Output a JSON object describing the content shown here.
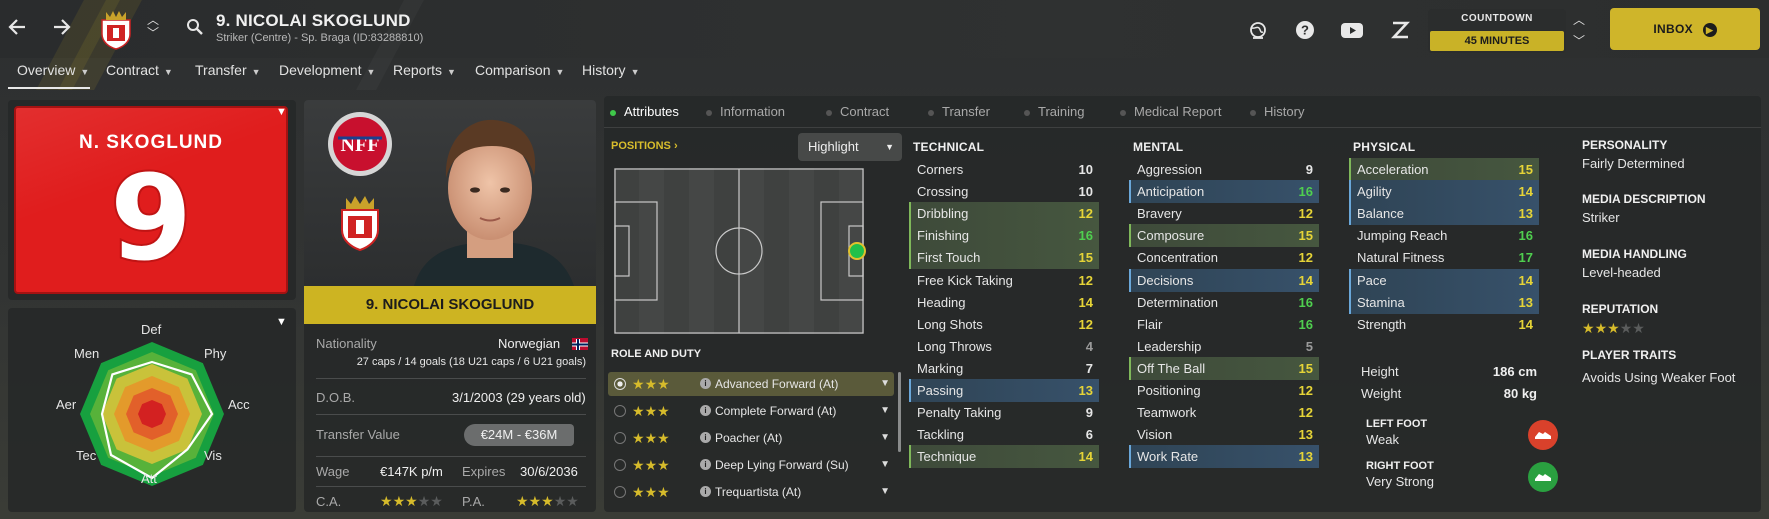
{
  "header": {
    "title": "9. NICOLAI SKOGLUND",
    "subtitle": "Striker (Centre) - Sp. Braga (ID:83288810)",
    "countdown_label": "COUNTDOWN",
    "countdown_value": "45 MINUTES",
    "inbox_label": "INBOX",
    "icons": [
      "back-arrow-icon",
      "forward-arrow-icon",
      "club-crest-icon",
      "up-down-arrows-icon",
      "search-icon",
      "globe-icon",
      "help-icon",
      "youtube-icon",
      "z-icon"
    ]
  },
  "nav": {
    "tabs": [
      "Overview",
      "Contract",
      "Transfer",
      "Development",
      "Reports",
      "Comparison",
      "History"
    ],
    "active": "Overview"
  },
  "kit": {
    "name": "N. SKOGLUND",
    "number": "9",
    "color": "#e01d1d"
  },
  "radar": {
    "labels": [
      "Def",
      "Phy",
      "Acc",
      "Vis",
      "Att",
      "Tec",
      "Aer",
      "Men"
    ]
  },
  "profile": {
    "banner": "9. NICOLAI SKOGLUND",
    "nationality_label": "Nationality",
    "nationality": "Norwegian",
    "caps": "27 caps / 14 goals (18 U21 caps / 6 U21 goals)",
    "dob_label": "D.O.B.",
    "dob": "3/1/2003 (29 years old)",
    "transfer_label": "Transfer Value",
    "transfer_value": "€24M - €36M",
    "wage_label": "Wage",
    "wage": "€147K p/m",
    "expires_label": "Expires",
    "expires": "30/6/2036",
    "ca_label": "C.A.",
    "pa_label": "P.A.",
    "ca_stars": 3,
    "pa_stars": 3
  },
  "subtabs": [
    "Attributes",
    "Information",
    "Contract",
    "Transfer",
    "Training",
    "Medical Report",
    "History"
  ],
  "positions": {
    "label": "POSITIONS",
    "highlight": "Highlight"
  },
  "role_duty": {
    "label": "ROLE AND DUTY",
    "roles": [
      {
        "name": "Advanced Forward (At)",
        "stars": 3,
        "selected": true
      },
      {
        "name": "Complete Forward (At)",
        "stars": 3,
        "selected": false
      },
      {
        "name": "Poacher (At)",
        "stars": 3,
        "selected": false
      },
      {
        "name": "Deep Lying Forward (Su)",
        "stars": 3,
        "selected": false
      },
      {
        "name": "Trequartista (At)",
        "stars": 3,
        "selected": false
      }
    ]
  },
  "technical": {
    "label": "TECHNICAL",
    "attrs": [
      {
        "name": "Corners",
        "value": "10",
        "hl": ""
      },
      {
        "name": "Crossing",
        "value": "10",
        "hl": ""
      },
      {
        "name": "Dribbling",
        "value": "12",
        "hl": "g"
      },
      {
        "name": "Finishing",
        "value": "16",
        "hl": "g"
      },
      {
        "name": "First Touch",
        "value": "15",
        "hl": "g"
      },
      {
        "name": "Free Kick Taking",
        "value": "12",
        "hl": ""
      },
      {
        "name": "Heading",
        "value": "14",
        "hl": ""
      },
      {
        "name": "Long Shots",
        "value": "12",
        "hl": ""
      },
      {
        "name": "Long Throws",
        "value": "4",
        "hl": ""
      },
      {
        "name": "Marking",
        "value": "7",
        "hl": ""
      },
      {
        "name": "Passing",
        "value": "13",
        "hl": "b"
      },
      {
        "name": "Penalty Taking",
        "value": "9",
        "hl": ""
      },
      {
        "name": "Tackling",
        "value": "6",
        "hl": ""
      },
      {
        "name": "Technique",
        "value": "14",
        "hl": "g"
      }
    ]
  },
  "mental": {
    "label": "MENTAL",
    "attrs": [
      {
        "name": "Aggression",
        "value": "9",
        "hl": ""
      },
      {
        "name": "Anticipation",
        "value": "16",
        "hl": "b"
      },
      {
        "name": "Bravery",
        "value": "12",
        "hl": ""
      },
      {
        "name": "Composure",
        "value": "15",
        "hl": "g"
      },
      {
        "name": "Concentration",
        "value": "12",
        "hl": ""
      },
      {
        "name": "Decisions",
        "value": "14",
        "hl": "b"
      },
      {
        "name": "Determination",
        "value": "16",
        "hl": ""
      },
      {
        "name": "Flair",
        "value": "16",
        "hl": ""
      },
      {
        "name": "Leadership",
        "value": "5",
        "hl": ""
      },
      {
        "name": "Off The Ball",
        "value": "15",
        "hl": "g"
      },
      {
        "name": "Positioning",
        "value": "12",
        "hl": ""
      },
      {
        "name": "Teamwork",
        "value": "12",
        "hl": ""
      },
      {
        "name": "Vision",
        "value": "13",
        "hl": ""
      },
      {
        "name": "Work Rate",
        "value": "13",
        "hl": "b"
      }
    ]
  },
  "physical": {
    "label": "PHYSICAL",
    "attrs": [
      {
        "name": "Acceleration",
        "value": "15",
        "hl": "g"
      },
      {
        "name": "Agility",
        "value": "14",
        "hl": "b"
      },
      {
        "name": "Balance",
        "value": "13",
        "hl": "b"
      },
      {
        "name": "Jumping Reach",
        "value": "16",
        "hl": ""
      },
      {
        "name": "Natural Fitness",
        "value": "17",
        "hl": ""
      },
      {
        "name": "Pace",
        "value": "14",
        "hl": "b"
      },
      {
        "name": "Stamina",
        "value": "13",
        "hl": "b"
      },
      {
        "name": "Strength",
        "value": "14",
        "hl": ""
      }
    ],
    "height_label": "Height",
    "height": "186 cm",
    "weight_label": "Weight",
    "weight": "80 kg",
    "left_foot_label": "LEFT FOOT",
    "left_foot": "Weak",
    "right_foot_label": "RIGHT FOOT",
    "right_foot": "Very Strong"
  },
  "info": {
    "personality_label": "PERSONALITY",
    "personality": "Fairly Determined",
    "media_desc_label": "MEDIA DESCRIPTION",
    "media_desc": "Striker",
    "media_handling_label": "MEDIA HANDLING",
    "media_handling": "Level-headed",
    "reputation_label": "REPUTATION",
    "reputation_stars": 3,
    "traits_label": "PLAYER TRAITS",
    "traits": "Avoids Using Weaker Foot"
  },
  "colors": {
    "accent": "#cfb52a",
    "good": "#4fcf4f",
    "ok": "#e6d437",
    "low": "#e6e6e6",
    "star": "#d6bb2b"
  }
}
